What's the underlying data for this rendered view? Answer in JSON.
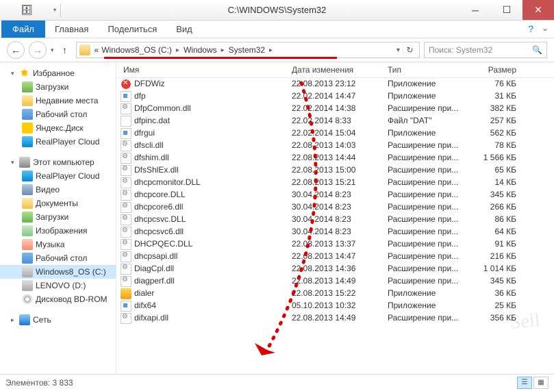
{
  "window": {
    "title": "C:\\WINDOWS\\System32"
  },
  "ribbon": {
    "file": "Файл",
    "tabs": [
      "Главная",
      "Поделиться",
      "Вид"
    ]
  },
  "breadcrumb": {
    "prefix": "«",
    "items": [
      "Windows8_OS (C:)",
      "Windows",
      "System32"
    ]
  },
  "search": {
    "placeholder": "Поиск: System32"
  },
  "sidebar": {
    "favorites": {
      "label": "Избранное",
      "items": [
        {
          "label": "Загрузки",
          "ico": "download"
        },
        {
          "label": "Недавние места",
          "ico": "folder"
        },
        {
          "label": "Рабочий стол",
          "ico": "desktop"
        },
        {
          "label": "Яндекс.Диск",
          "ico": "yandex"
        },
        {
          "label": "RealPlayer Cloud",
          "ico": "realplayer"
        }
      ]
    },
    "computer": {
      "label": "Этот компьютер",
      "items": [
        {
          "label": "RealPlayer Cloud",
          "ico": "realplayer"
        },
        {
          "label": "Видео",
          "ico": "video"
        },
        {
          "label": "Документы",
          "ico": "docs"
        },
        {
          "label": "Загрузки",
          "ico": "download"
        },
        {
          "label": "Изображения",
          "ico": "images"
        },
        {
          "label": "Музыка",
          "ico": "music"
        },
        {
          "label": "Рабочий стол",
          "ico": "desktop"
        },
        {
          "label": "Windows8_OS (C:)",
          "ico": "drive",
          "selected": true
        },
        {
          "label": "LENOVO (D:)",
          "ico": "drive"
        },
        {
          "label": "Дисковод BD-ROM",
          "ico": "cd"
        }
      ]
    },
    "network": {
      "label": "Сеть"
    }
  },
  "columns": {
    "name": "Имя",
    "date": "Дата изменения",
    "type": "Тип",
    "size": "Размер"
  },
  "files": [
    {
      "name": "DFDWiz",
      "date": "22.08.2013 23:12",
      "type": "Приложение",
      "size": "76 КБ",
      "ico": "red"
    },
    {
      "name": "dfp",
      "date": "22.02.2014 14:47",
      "type": "Приложение",
      "size": "31 КБ",
      "ico": "app"
    },
    {
      "name": "DfpCommon.dll",
      "date": "22.02.2014 14:38",
      "type": "Расширение при...",
      "size": "382 КБ",
      "ico": "dll"
    },
    {
      "name": "dfpinc.dat",
      "date": "22.02.2014 8:33",
      "type": "Файл \"DAT\"",
      "size": "257 КБ",
      "ico": "dat"
    },
    {
      "name": "dfrgui",
      "date": "22.02.2014 15:04",
      "type": "Приложение",
      "size": "562 КБ",
      "ico": "app"
    },
    {
      "name": "dfscli.dll",
      "date": "22.08.2013 14:03",
      "type": "Расширение при...",
      "size": "78 КБ",
      "ico": "dll"
    },
    {
      "name": "dfshim.dll",
      "date": "22.08.2013 14:44",
      "type": "Расширение при...",
      "size": "1 566 КБ",
      "ico": "dll"
    },
    {
      "name": "DfsShlEx.dll",
      "date": "22.08.2013 15:00",
      "type": "Расширение при...",
      "size": "65 КБ",
      "ico": "dll"
    },
    {
      "name": "dhcpcmonitor.DLL",
      "date": "22.08.2013 15:21",
      "type": "Расширение при...",
      "size": "14 КБ",
      "ico": "dll"
    },
    {
      "name": "dhcpcore.DLL",
      "date": "30.04.2014 8:23",
      "type": "Расширение при...",
      "size": "345 КБ",
      "ico": "dll"
    },
    {
      "name": "dhcpcore6.dll",
      "date": "30.04.2014 8:23",
      "type": "Расширение при...",
      "size": "266 КБ",
      "ico": "dll"
    },
    {
      "name": "dhcpcsvc.DLL",
      "date": "30.04.2014 8:23",
      "type": "Расширение при...",
      "size": "86 КБ",
      "ico": "dll"
    },
    {
      "name": "dhcpcsvc6.dll",
      "date": "30.04.2014 8:23",
      "type": "Расширение при...",
      "size": "64 КБ",
      "ico": "dll"
    },
    {
      "name": "DHCPQEC.DLL",
      "date": "22.08.2013 13:37",
      "type": "Расширение при...",
      "size": "91 КБ",
      "ico": "dll"
    },
    {
      "name": "dhcpsapi.dll",
      "date": "22.08.2013 14:47",
      "type": "Расширение при...",
      "size": "216 КБ",
      "ico": "dll"
    },
    {
      "name": "DiagCpl.dll",
      "date": "22.08.2013 14:36",
      "type": "Расширение при...",
      "size": "1 014 КБ",
      "ico": "dll"
    },
    {
      "name": "diagperf.dll",
      "date": "22.08.2013 14:49",
      "type": "Расширение при...",
      "size": "345 КБ",
      "ico": "dll"
    },
    {
      "name": "dialer",
      "date": "22.08.2013 15:22",
      "type": "Приложение",
      "size": "36 КБ",
      "ico": "dialer"
    },
    {
      "name": "difx64",
      "date": "05.10.2013 10:32",
      "type": "Приложение",
      "size": "25 КБ",
      "ico": "app"
    },
    {
      "name": "difxapi.dll",
      "date": "22.08.2013 14:49",
      "type": "Расширение при...",
      "size": "356 КБ",
      "ico": "dll"
    }
  ],
  "status": {
    "count_label": "Элементов:",
    "count": "3 833"
  },
  "watermark": "Sell"
}
